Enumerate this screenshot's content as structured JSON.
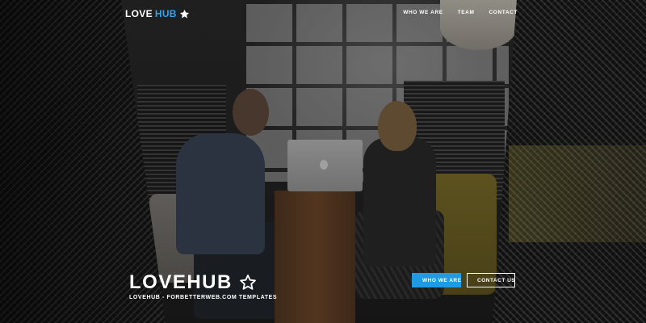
{
  "brand": {
    "part1": "LOVE",
    "part2": "HUB",
    "icon": "star-icon",
    "color_primary": "#ffffff",
    "color_accent": "#2ea3f2"
  },
  "nav": {
    "items": [
      {
        "label": "WHO WE ARE"
      },
      {
        "label": "TEAM"
      },
      {
        "label": "CONTACT"
      }
    ]
  },
  "hero": {
    "title_part1": "LOVE",
    "title_part2": "HUB",
    "title_icon": "star-outline-icon",
    "subtitle": "LOVEHUB - FORBETTERWEB.COM TEMPLATES"
  },
  "buttons": {
    "who_we_are": {
      "label": "WHO WE ARE",
      "icon": "chevron-down-icon",
      "color": "#1e9be3"
    },
    "contact_us": {
      "label": "CONTACT US",
      "icon": "chevron-down-icon"
    }
  }
}
